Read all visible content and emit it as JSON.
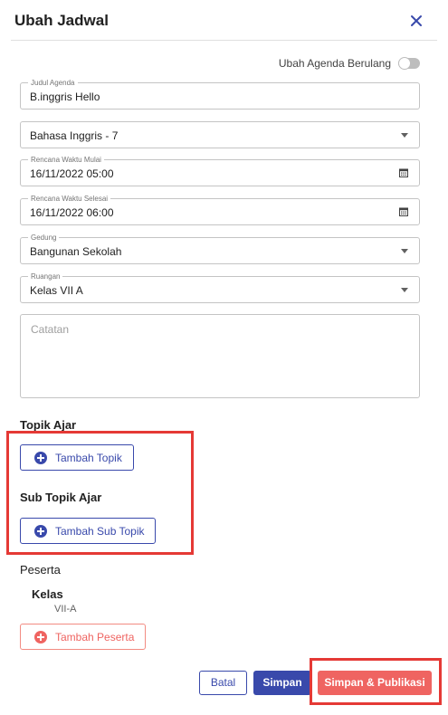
{
  "dialog": {
    "title": "Ubah Jadwal"
  },
  "recurring": {
    "label": "Ubah Agenda Berulang",
    "enabled": false
  },
  "fields": {
    "judul": {
      "legend": "Judul Agenda",
      "value": "B.inggris Hello"
    },
    "subject": {
      "value": "Bahasa Inggris - 7"
    },
    "mulai": {
      "legend": "Rencana Waktu Mulai",
      "value": "16/11/2022 05:00"
    },
    "selesai": {
      "legend": "Rencana Waktu Selesai",
      "value": "16/11/2022 06:00"
    },
    "gedung": {
      "legend": "Gedung",
      "value": "Bangunan Sekolah"
    },
    "ruangan": {
      "legend": "Ruangan",
      "value": "Kelas VII A"
    },
    "catatan": {
      "placeholder": "Catatan"
    }
  },
  "topik": {
    "title": "Topik Ajar",
    "button": "Tambah Topik"
  },
  "subtopik": {
    "title": "Sub Topik Ajar",
    "button": "Tambah Sub Topik"
  },
  "peserta": {
    "title": "Peserta",
    "kelas_heading": "Kelas",
    "kelas_value": "VII-A",
    "button": "Tambah Peserta"
  },
  "footer": {
    "batal": "Batal",
    "simpan": "Simpan",
    "publikasi": "Simpan & Publikasi"
  },
  "colors": {
    "primary": "#3949ab",
    "accent": "#ef6461",
    "highlight": "#e53935"
  }
}
